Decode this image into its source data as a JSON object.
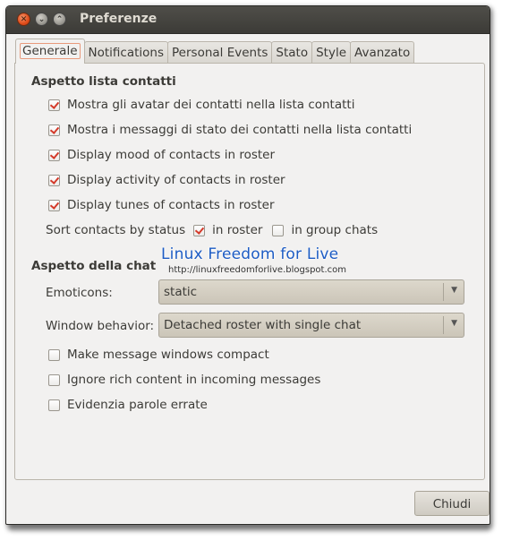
{
  "window": {
    "title": "Preferenze"
  },
  "tabs": [
    "Generale",
    "Notifications",
    "Personal Events",
    "Stato",
    "Style",
    "Avanzato"
  ],
  "contact_list": {
    "title": "Aspetto lista contatti",
    "options": [
      {
        "label": "Mostra gli avatar dei contatti nella lista contatti",
        "checked": true
      },
      {
        "label": "Mostra i messaggi di stato dei contatti nella lista contatti",
        "checked": true
      },
      {
        "label": "Display mood of contacts in roster",
        "checked": true
      },
      {
        "label": "Display activity of contacts in roster",
        "checked": true
      },
      {
        "label": "Display tunes of contacts in roster",
        "checked": true
      }
    ],
    "sort": {
      "label": "Sort contacts by status",
      "in_roster_label": "in roster",
      "in_roster_checked": true,
      "in_group_chats_label": "in group chats",
      "in_group_chats_checked": false
    }
  },
  "chat": {
    "title": "Aspetto della chat",
    "emoticons_label": "Emoticons:",
    "emoticons_value": "static",
    "window_behavior_label": "Window behavior:",
    "window_behavior_value": "Detached roster with single chat",
    "options": [
      {
        "label": "Make message windows compact",
        "checked": false
      },
      {
        "label": "Ignore rich content in incoming messages",
        "checked": false
      },
      {
        "label": "Evidenzia parole errate",
        "checked": false
      }
    ]
  },
  "watermark": {
    "title": "Linux Freedom for Live",
    "url": "http://linuxfreedomforlive.blogspot.com"
  },
  "footer": {
    "close_label": "Chiudi"
  },
  "colors": {
    "accent": "#d43a2a",
    "titlebar": "#3c3b37",
    "window_bg": "#f2f1f0"
  }
}
